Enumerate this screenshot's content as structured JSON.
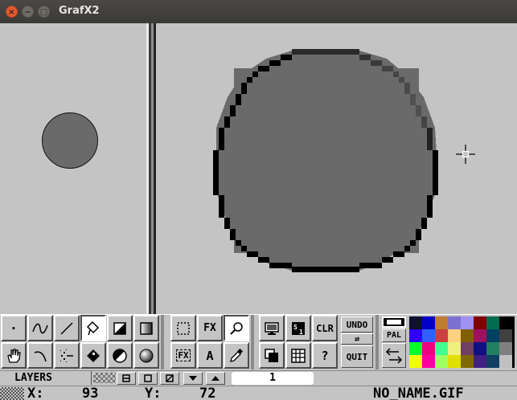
{
  "window": {
    "title": "GrafX2",
    "close_glyph": "×",
    "minimize_glyph": "−",
    "maximize_glyph": "□"
  },
  "toolbar": {
    "row1": [
      {
        "name": "dot-pen-icon",
        "label": "·"
      },
      {
        "name": "freehand-curve-icon",
        "label": ""
      },
      {
        "name": "line-icon",
        "label": ""
      },
      {
        "name": "fill-bucket-icon",
        "label": ""
      },
      {
        "name": "filled-rectangle-icon",
        "label": ""
      },
      {
        "name": "gradient-rectangle-icon",
        "label": ""
      }
    ],
    "row2": [
      {
        "name": "hand-icon",
        "label": ""
      },
      {
        "name": "bezier-curve-icon",
        "label": ""
      },
      {
        "name": "airbrush-icon",
        "label": ""
      },
      {
        "name": "polygon-fill-icon",
        "label": ""
      },
      {
        "name": "filled-ellipse-icon",
        "label": ""
      },
      {
        "name": "gradient-sphere-icon",
        "label": ""
      }
    ],
    "brush_select_label": "",
    "fx_label": "FX",
    "fx_text_label": "FX",
    "text_tool_label": "A",
    "clear_label": "CLR",
    "help_label": "?",
    "undo_label": "UNDO",
    "redo_glyph": "⇄",
    "quit_label": "QUIT",
    "pal_label": "PAL"
  },
  "palette": {
    "colors": [
      "#101030",
      "#0000cc",
      "#c07c30",
      "#7c70d0",
      "#a090f0",
      "#800000",
      "#006c50",
      "#000000",
      "#3000ff",
      "#3060ff",
      "#cc4040",
      "#ffd080",
      "#806000",
      "#a01060",
      "#004060",
      "#404040",
      "#00ff30",
      "#f00080",
      "#40ff90",
      "#f0f080",
      "#704060",
      "#101080",
      "#208060",
      "#808080",
      "#f0ff00",
      "#ff00a0",
      "#a0ff60",
      "#e0e000",
      "#806800",
      "#402080",
      "#104060",
      "#c0c0c0"
    ]
  },
  "layers": {
    "label": "LAYERS",
    "current": "1"
  },
  "status": {
    "x_label": "X:",
    "x_value": "93",
    "y_label": "Y:",
    "y_value": "72",
    "filename": "NO_NAME.GIF"
  },
  "canvas": {
    "background": "#c4c4c4",
    "circle_fill": "#6a6a6a",
    "circle_outline": "#000000"
  }
}
